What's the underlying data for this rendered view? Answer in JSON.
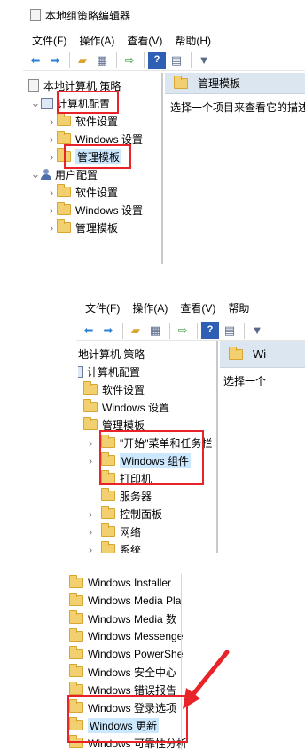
{
  "window_title": "本地组策略编辑器",
  "menu": [
    "文件(F)",
    "操作(A)",
    "查看(V)",
    "帮助(H)"
  ],
  "panel1": {
    "tree": {
      "root": "本地计算机 策略",
      "computer_config": "计算机配置",
      "software_settings": "软件设置",
      "windows_settings": "Windows 设置",
      "admin_templates": "管理模板",
      "user_config": "用户配置",
      "user_software_settings": "软件设置",
      "user_windows_settings": "Windows 设置",
      "user_admin_templates": "管理模板"
    },
    "right_header": "管理模板",
    "right_text": "选择一个项目来查看它的描述"
  },
  "panel2": {
    "menu": [
      "文件(F)",
      "操作(A)",
      "查看(V)",
      "帮助"
    ],
    "tree": {
      "root": "地计算机 策略",
      "computer_config": "计算机配置",
      "software_settings": "软件设置",
      "windows_settings": "Windows 设置",
      "admin_templates": "管理模板",
      "start_menu": "\"开始\"菜单和任务栏",
      "windows_components": "Windows 组件",
      "printers": "打印机",
      "server": "服务器",
      "control_panel": "控制面板",
      "network": "网络",
      "system": "系统"
    },
    "right_header": "Wi",
    "right_text": "选择一个"
  },
  "panel3": {
    "items": [
      "Windows Installer",
      "Windows Media Pla",
      "Windows Media 数",
      "Windows Messenge",
      "Windows PowerShe",
      "Windows 安全中心",
      "Windows 错误报告",
      "Windows 登录选项",
      "Windows 更新",
      "Windows 可靠性分析"
    ]
  },
  "colors": {
    "highlight": "#e8232a",
    "selection": "#cce8ff",
    "header_bg": "#dce6f0"
  }
}
